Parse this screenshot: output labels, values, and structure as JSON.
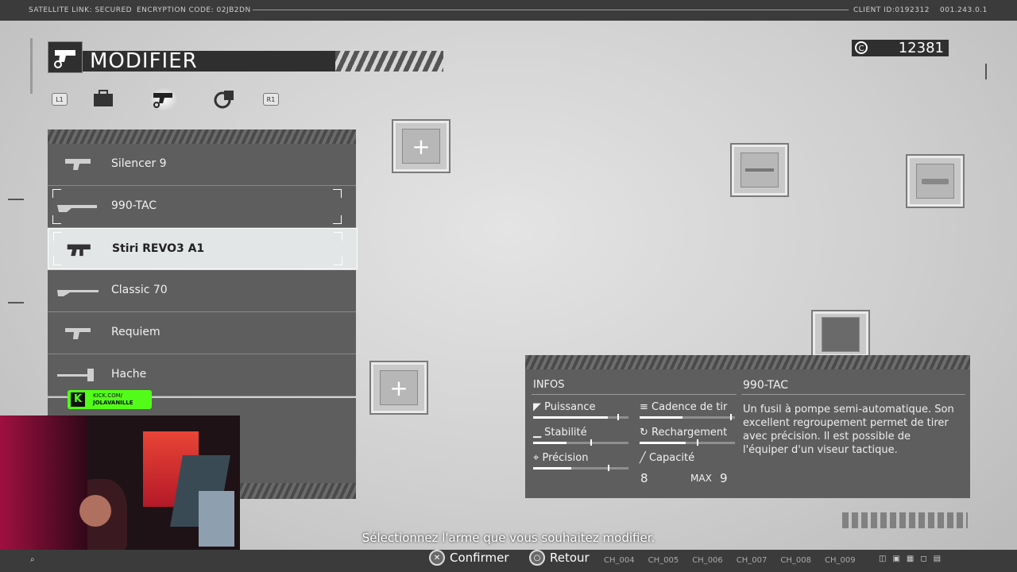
{
  "topbar": {
    "satellite": "SATELLITE LINK: SECURED",
    "encryption": "ENCRYPTION CODE: 02JB2DN",
    "client": "CLIENT ID:0192312",
    "code": "001.243.0.1"
  },
  "header": {
    "title": "MODIFIER",
    "credits": "12381",
    "tab_left": "L1",
    "tab_right": "R1"
  },
  "weapons": [
    {
      "label": "Silencer 9"
    },
    {
      "label": "990-TAC"
    },
    {
      "label": "Stiri REVO3 A1"
    },
    {
      "label": "Classic 70"
    },
    {
      "label": "Requiem"
    },
    {
      "label": "Hache"
    }
  ],
  "info": {
    "heading": "INFOS",
    "weapon_name": "990-TAC",
    "stats": {
      "puissance": {
        "label": "Puissance",
        "value": 0.78,
        "max": 0.88
      },
      "cadence": {
        "label": "Cadence de tir",
        "value": 0.45,
        "max": 0.95
      },
      "stabilite": {
        "label": "Stabilité",
        "value": 0.35,
        "max": 0.6
      },
      "rechargement": {
        "label": "Rechargement",
        "value": 0.48,
        "max": 0.6
      },
      "precision": {
        "label": "Précision",
        "value": 0.4,
        "max": 0.78
      },
      "capacite": {
        "label": "Capacité",
        "value": "8",
        "max_label": "MAX",
        "max": "9"
      }
    },
    "description": "Un fusil à pompe semi-automatique. Son excellent regroupement permet de tirer avec précision. Il est possible de l'équiper d'un viseur tactique."
  },
  "overlay": {
    "kick_top": "KICK.COM/",
    "kick_name": "JOLAVANILLE"
  },
  "footer": {
    "hint": "Sélectionnez l'arme que vous souhaitez modifier.",
    "confirm": "Confirmer",
    "back": "Retour",
    "channels": [
      "CH_004",
      "CH_005",
      "CH_006",
      "CH_007",
      "CH_008",
      "CH_009"
    ]
  },
  "colors": {
    "panel": "#5e5e5e",
    "selected": "#e3e6e6",
    "kick_green": "#53fc18"
  }
}
